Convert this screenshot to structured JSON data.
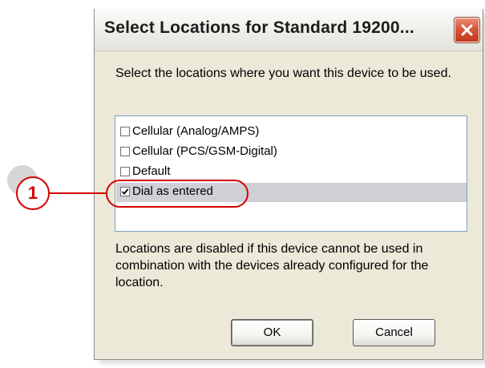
{
  "dialog": {
    "title": "Select Locations for Standard 19200...",
    "instruction": "Select the locations where you want this device to be used.",
    "locations": [
      {
        "label": "Cellular (Analog/AMPS)",
        "checked": false,
        "selected": false
      },
      {
        "label": "Cellular (PCS/GSM-Digital)",
        "checked": false,
        "selected": false
      },
      {
        "label": "Default",
        "checked": false,
        "selected": false
      },
      {
        "label": "Dial as entered",
        "checked": true,
        "selected": true
      }
    ],
    "note": "Locations are disabled if this device cannot be used in combination with the devices already configured for the location.",
    "ok_label": "OK",
    "cancel_label": "Cancel"
  },
  "callout": {
    "number": "1",
    "color": "#d40000"
  },
  "icons": {
    "close": "close-x-icon",
    "checkmark": "checkmark-icon"
  }
}
